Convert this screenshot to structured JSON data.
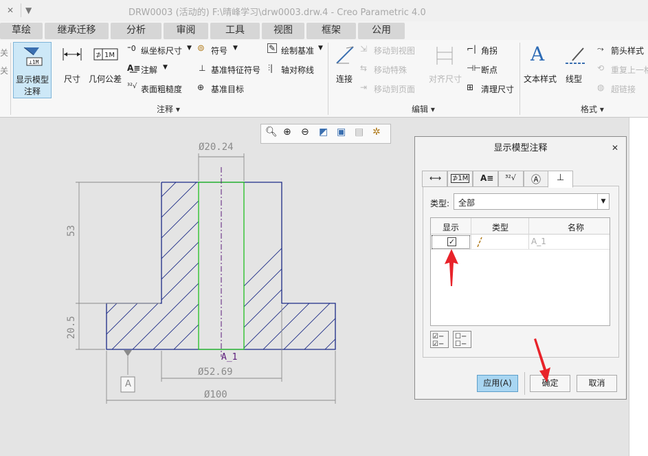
{
  "window": {
    "title": "DRW0003 (活动的) F:\\晴峰学习\\drw0003.drw.4 - Creo Parametric 4.0",
    "qa_close": "✕",
    "qa_dropdown": "▼"
  },
  "tabs": [
    "草绘",
    "继承迁移",
    "分析",
    "审阅",
    "工具",
    "视图",
    "框架",
    "公用"
  ],
  "ribbon": {
    "left_partial": [
      "关",
      "关"
    ],
    "show_model_annotations": {
      "line1": "显示模型",
      "line2": "注释"
    },
    "dimension": "尺寸",
    "geo_tol": "几何公差",
    "ordinate_dim": "纵坐标尺寸",
    "annotation": "注解",
    "surface_finish": "表面粗糙度",
    "symbol": "符号",
    "datum_feature_symbol": "基准特征符号",
    "datum_target": "基准目标",
    "draw_datum": "绘制基准",
    "axis_symmetry": "轴对称线",
    "group_annotate": "注释",
    "connect": "连接",
    "move_to_view": "移动到视图",
    "move_special": "移动特殊",
    "move_to_page": "移动到页面",
    "align_dims": "对齐尺寸",
    "angle_jog": "角拐",
    "breakpoint": "断点",
    "cleanup_dims": "清理尺寸",
    "group_edit": "编辑",
    "text_style": "文本样式",
    "line_style": "线型",
    "arrow_style": "箭头样式",
    "repeat_last": "重复上一格",
    "hyperlink": "超链接",
    "group_format": "格式"
  },
  "drawing": {
    "dim_top_dia": "Ø20.24",
    "dim_mid_dia": "Ø52.69",
    "dim_bottom_dia": "Ø100",
    "dim_53": "53",
    "dim_20_5": "20.5",
    "axis_label": "A_1",
    "datum_label": "A"
  },
  "dialog": {
    "title": "显示模型注释",
    "close": "✕",
    "type_label": "类型:",
    "type_value": "全部",
    "columns": [
      "显示",
      "类型",
      "名称"
    ],
    "row": {
      "checked": true,
      "type_icon": "axis-icon",
      "name": "A_1"
    },
    "apply": "应用(A)",
    "ok": "确定",
    "cancel": "取消"
  },
  "colors": {
    "geometry": "#1b2a86",
    "hole": "#1fbf1f",
    "dims": "#8a8a8a",
    "annotation_red": "#e8232a",
    "apply_button": "#a9d6f2"
  }
}
